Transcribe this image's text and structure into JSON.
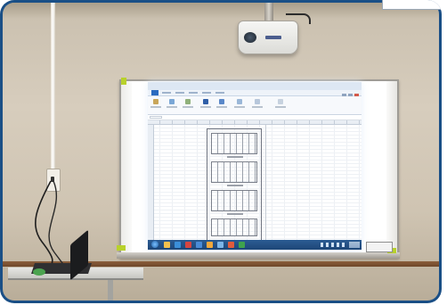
{
  "scene": {
    "subject": "classroom-interactive-whiteboard",
    "colors": {
      "frame": "#1a4f86",
      "wall": "#cfc4b2",
      "board": "#ffffff",
      "tape": "#b8d12b",
      "taskbar": "#2c5c93",
      "app_file_tab": "#2b6bbf",
      "dado_rail": "#7a4f31"
    }
  },
  "objects": [
    {
      "name": "ceiling-projector",
      "icon": "projector-icon"
    },
    {
      "name": "whiteboard",
      "icon": "whiteboard-icon"
    },
    {
      "name": "projected-spreadsheet",
      "icon": "spreadsheet-icon"
    },
    {
      "name": "laptop",
      "icon": "laptop-icon"
    },
    {
      "name": "desk",
      "icon": "desk-icon"
    },
    {
      "name": "wall-outlet",
      "icon": "outlet-icon"
    }
  ],
  "projection": {
    "window_title": "",
    "taskbar_icons": [
      {
        "name": "task-icon-1",
        "color": "#f2c14e"
      },
      {
        "name": "task-icon-2",
        "color": "#3b8fd9"
      },
      {
        "name": "task-icon-3",
        "color": "#d64541"
      },
      {
        "name": "task-icon-4",
        "color": "#4a8bd6"
      },
      {
        "name": "task-icon-5",
        "color": "#f3a83b"
      },
      {
        "name": "task-icon-6",
        "color": "#7cb5e8"
      },
      {
        "name": "task-icon-7",
        "color": "#e25b3c"
      },
      {
        "name": "task-icon-8",
        "color": "#3fa34d"
      }
    ]
  }
}
